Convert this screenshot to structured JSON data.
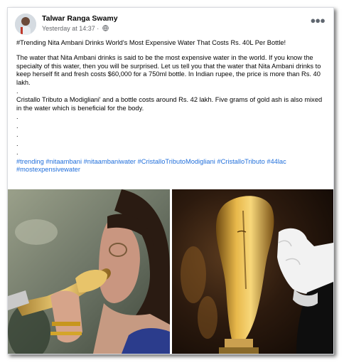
{
  "post": {
    "author": "Talwar Ranga Swamy",
    "timestamp": "Yesterday at 14:37",
    "separator": " · ",
    "headline": "#Trending Nita Ambani Drinks World's Most Expensive Water That Costs Rs. 40L Per Bottle!",
    "paragraph1": "The water that Nita Ambani drinks is said to be the most expensive water in the world. If you know the specialty of this water, then you will be surprised. Let us tell you that the water that Nita Ambani drinks to keep herself fit and fresh costs $60,000 for a 750ml bottle. In Indian rupee, the price is more than Rs. 40 lakh.",
    "paragraph2": "Cristallo Tributo a Modigliani' and a bottle costs around Rs. 42 lakh. Five grams of gold ash is also mixed in the water which is beneficial for the body.",
    "dot": ".",
    "hashtags": [
      "#trending",
      "#nitaambani",
      "#nitaambaniwater",
      "#CristalloTributoModigliani",
      "#CristalloTributo",
      "#44lac",
      "#mostexpensivewater"
    ]
  },
  "icons": {
    "globe": "globe-icon",
    "more": "more-options-icon",
    "avatar": "avatar"
  },
  "colors": {
    "link": "#216fdb",
    "meta": "#65676b",
    "text": "#050505"
  }
}
